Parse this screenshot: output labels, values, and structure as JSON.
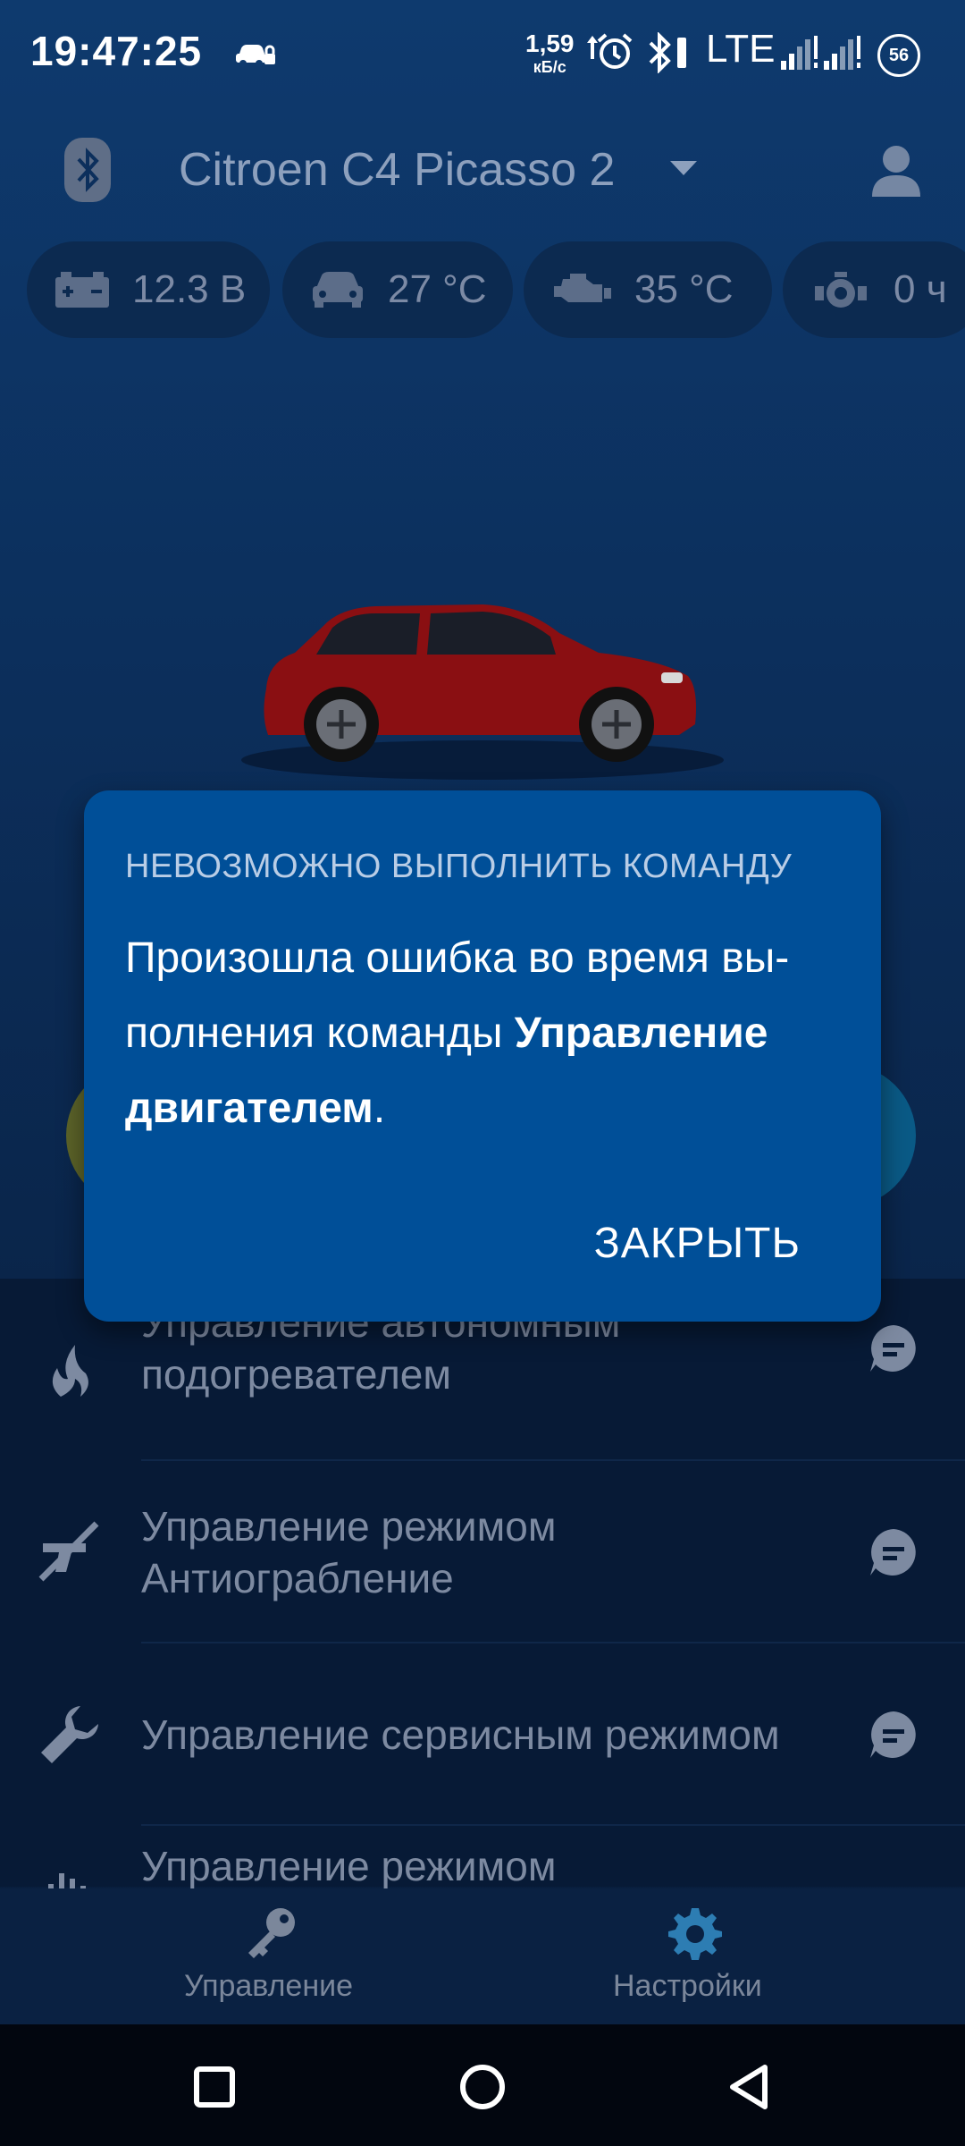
{
  "status_bar": {
    "time": "19:47:25",
    "net_speed_value": "1,59",
    "net_speed_unit": "кБ/с",
    "network": "LTE",
    "battery": "56"
  },
  "header": {
    "car_name": "Citroen C4 Picasso 2"
  },
  "chips": [
    {
      "icon": "battery-icon",
      "value": "12.3 В"
    },
    {
      "icon": "car-temp-icon",
      "value": "27 °C"
    },
    {
      "icon": "engine-icon",
      "value": "35 °C"
    },
    {
      "icon": "engine-hours-icon",
      "value": "0 ч"
    }
  ],
  "list": {
    "items": [
      {
        "label": "Управление автономным подогревателем",
        "icon": "heater-icon"
      },
      {
        "label": "Управление режимом Антиограбление",
        "icon": "anti-robbery-icon"
      },
      {
        "label": "Управление сервисным режимом",
        "icon": "wrench-icon"
      },
      {
        "label": "Управление режимом",
        "icon": "mode-icon"
      }
    ]
  },
  "bottom_nav": {
    "control": "Управление",
    "settings": "Настройки"
  },
  "dialog": {
    "title": "НЕВОЗМОЖНО ВЫПОЛНИТЬ КОМАНДУ",
    "message_prefix": "Произошла ошибка во время вы­полнения команды ",
    "message_bold": "Управление двигателем",
    "message_suffix": ".",
    "close_label": "ЗАКРЫТЬ"
  },
  "colors": {
    "dialog_bg": "#004f98",
    "app_bg": "#0c2f5c",
    "car_body": "#8a0f12"
  }
}
